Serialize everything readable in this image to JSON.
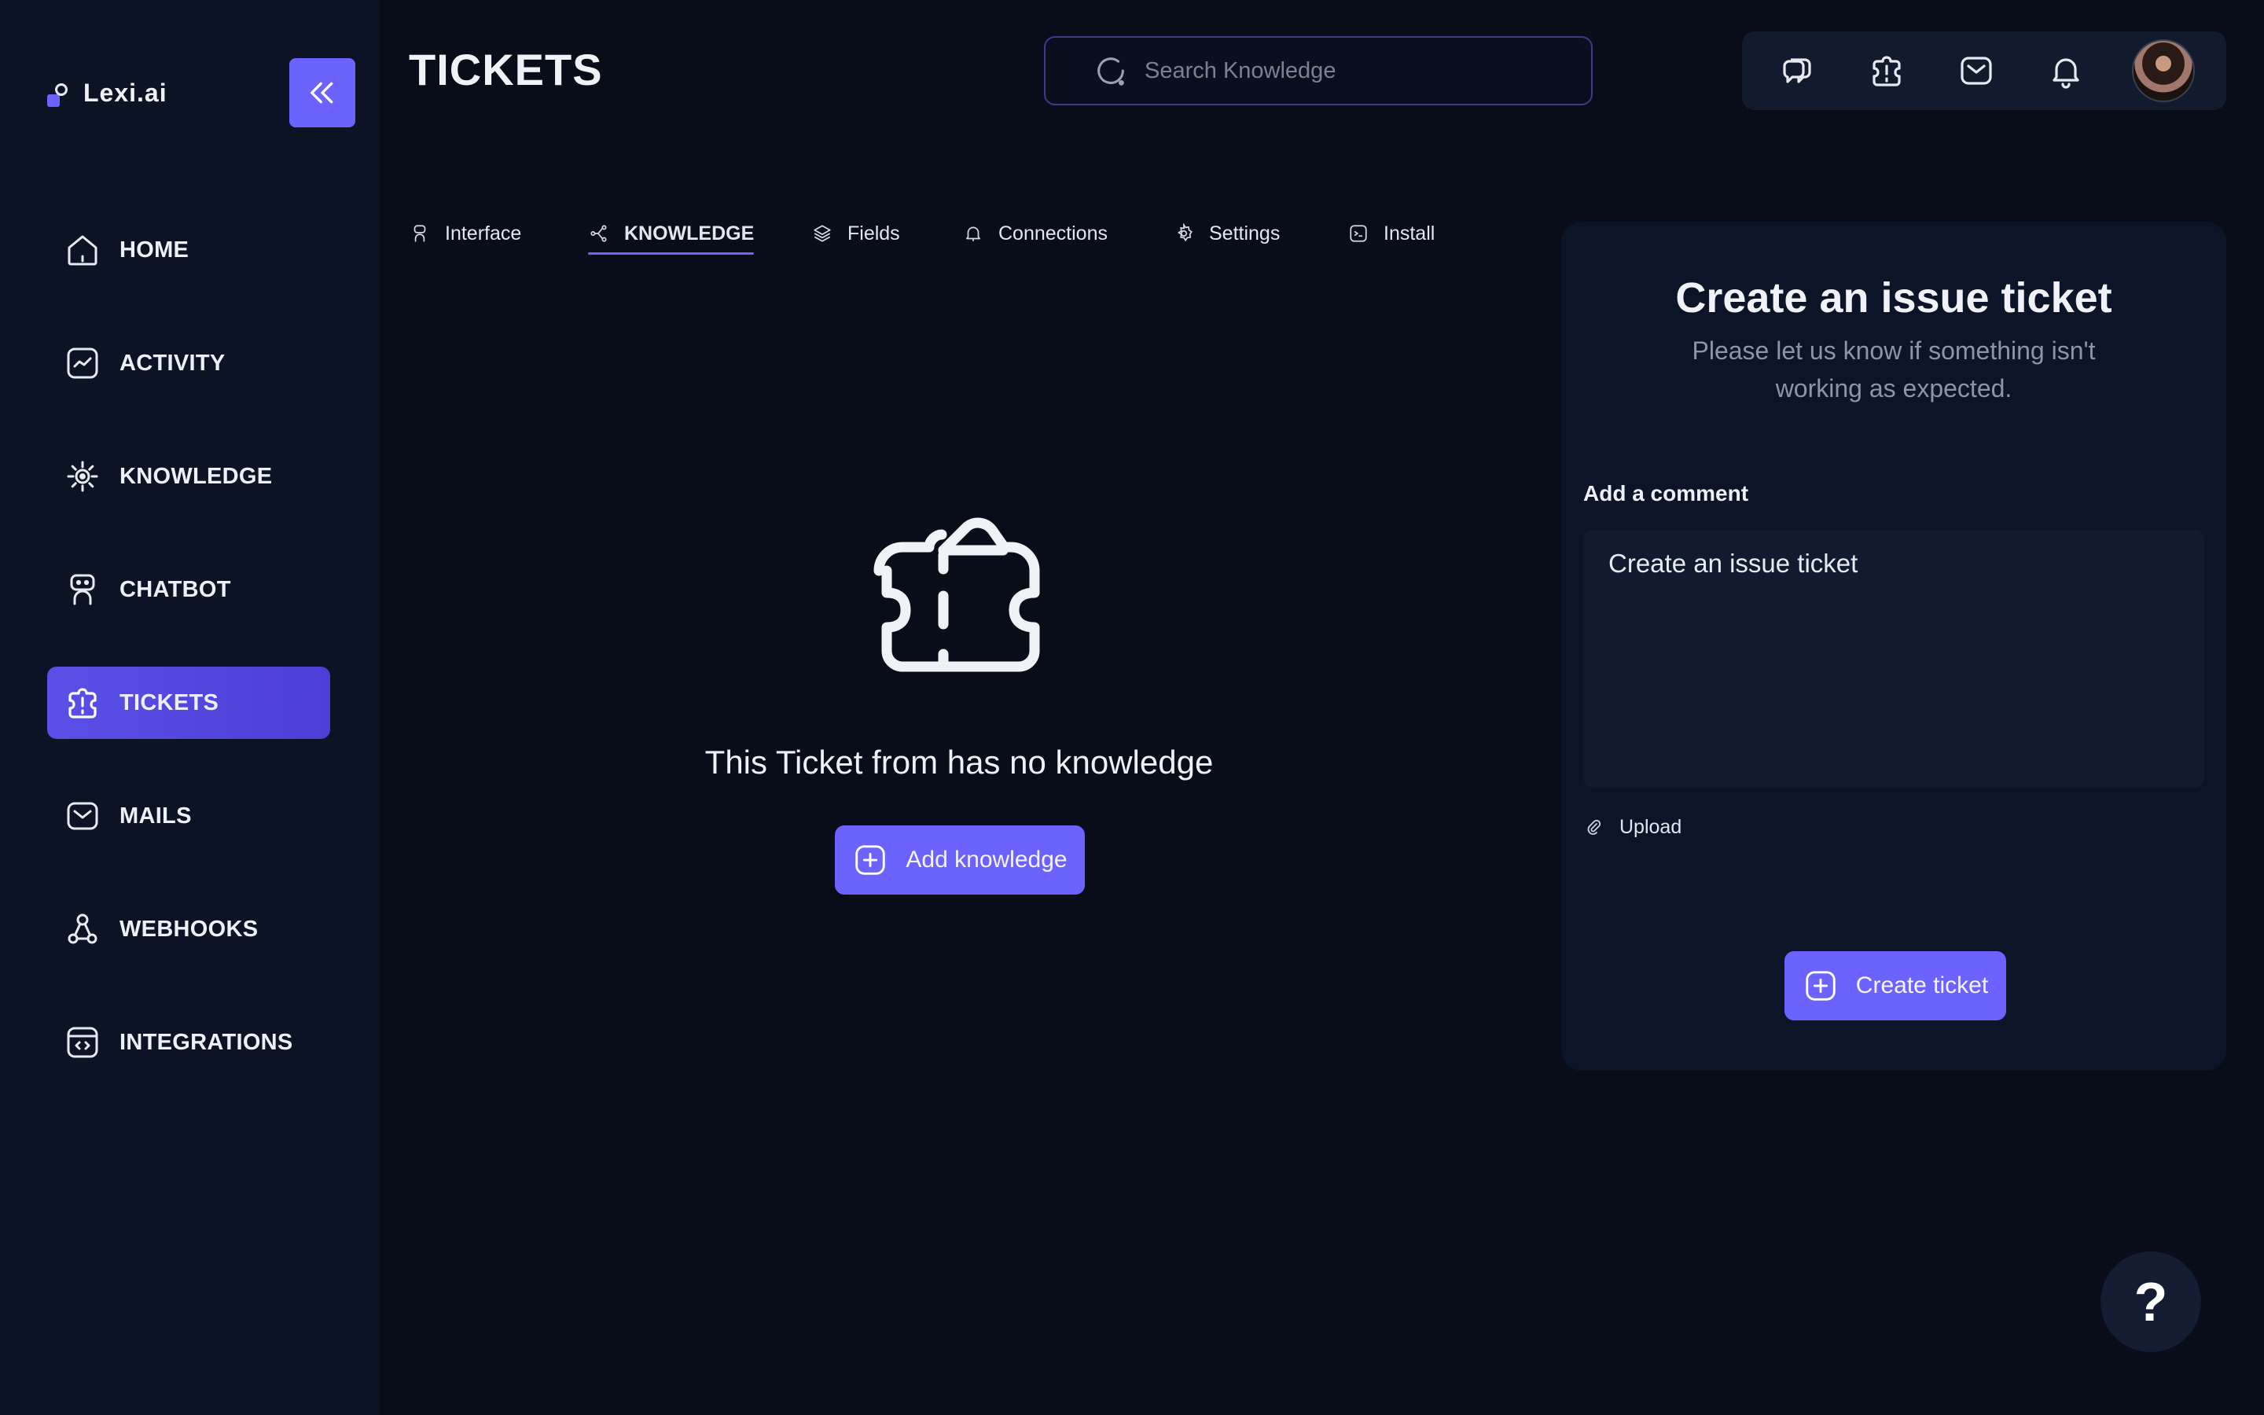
{
  "brand": {
    "name": "Lexi.ai"
  },
  "header": {
    "title": "TICKETS",
    "search_placeholder": "Search Knowledge"
  },
  "sidebar": {
    "items": [
      {
        "label": "HOME",
        "icon": "home-icon"
      },
      {
        "label": "ACTIVITY",
        "icon": "activity-icon"
      },
      {
        "label": "KNOWLEDGE",
        "icon": "knowledge-icon"
      },
      {
        "label": "CHATBOT",
        "icon": "chatbot-icon"
      },
      {
        "label": "TICKETS",
        "icon": "puzzle-icon",
        "active": true
      },
      {
        "label": "MAILS",
        "icon": "mail-icon"
      },
      {
        "label": "WEBHOOKS",
        "icon": "webhook-icon"
      },
      {
        "label": "INTEGRATIONS",
        "icon": "integrations-icon"
      }
    ]
  },
  "tabs": [
    {
      "label": "Interface",
      "icon": "robot-icon"
    },
    {
      "label": "KNOWLEDGE",
      "icon": "share-icon",
      "active": true
    },
    {
      "label": "Fields",
      "icon": "layers-icon"
    },
    {
      "label": "Connections",
      "icon": "bell-icon"
    },
    {
      "label": "Settings",
      "icon": "gear-icon"
    },
    {
      "label": "Install",
      "icon": "terminal-icon"
    }
  ],
  "empty_state": {
    "message": "This Ticket from has no knowledge",
    "button_label": "Add knowledge"
  },
  "panel": {
    "title": "Create an issue ticket",
    "subtitle": "Please let us know if something isn't working as expected.",
    "comment_label": "Add a comment",
    "comment_value": "Create an issue ticket",
    "upload_label": "Upload",
    "submit_label": "Create ticket"
  },
  "help": {
    "label": "?"
  },
  "colors": {
    "background": "#090d19",
    "sidebar": "#0c1324",
    "accent": "#6c63ff",
    "panel": "#0c1527"
  }
}
